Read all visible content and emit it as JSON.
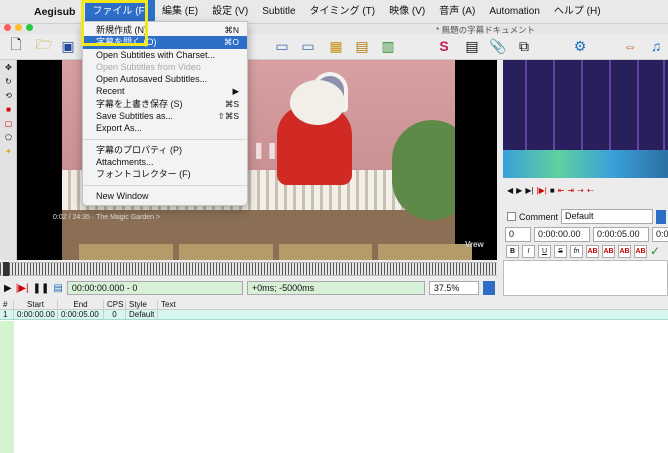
{
  "menubar": {
    "apple": "",
    "app_name": "Aegisub",
    "items": [
      {
        "label": "ファイル (F)",
        "active": true
      },
      {
        "label": "編集 (E)"
      },
      {
        "label": "設定 (V)"
      },
      {
        "label": "Subtitle"
      },
      {
        "label": "タイミング (T)"
      },
      {
        "label": "映像 (V)"
      },
      {
        "label": "音声 (A)"
      },
      {
        "label": "Automation"
      },
      {
        "label": "ヘルプ (H)"
      }
    ]
  },
  "window": {
    "title": "* 無題の字幕ドキュメント"
  },
  "file_menu": {
    "items": [
      {
        "label": "新規作成 (N)",
        "shortcut": "⌘N"
      },
      {
        "label": "字幕を開く (O)",
        "shortcut": "⌘O",
        "selected": true
      },
      {
        "label": "Open Subtitles with Charset..."
      },
      {
        "label": "Open Subtitles from Video",
        "disabled": true
      },
      {
        "label": "Open Autosaved Subtitles..."
      },
      {
        "label": "Recent",
        "shortcut": "▶"
      },
      {
        "label": "字幕を上書き保存 (S)",
        "shortcut": "⌘S"
      },
      {
        "label": "Save Subtitles as...",
        "shortcut": "⇧⌘S"
      },
      {
        "label": "Export As..."
      },
      {
        "separator": true
      },
      {
        "label": "字幕のプロパティ (P)"
      },
      {
        "label": "Attachments..."
      },
      {
        "label": "フォントコレクター (F)"
      },
      {
        "separator": true
      },
      {
        "label": "New Window"
      }
    ]
  },
  "video": {
    "caption": "0:02 / 24:35 · The Magic Garden >",
    "watermark": "Vrew"
  },
  "video_controls": {
    "time": "00:00:00.000 - 0",
    "offset": "+0ms; -5000ms",
    "zoom": "37.5%"
  },
  "edit_panel": {
    "comment_label": "Comment",
    "style": "Default",
    "layer": "0",
    "start": "0:00:00.00",
    "end": "0:00:05.00",
    "duration": "0:0",
    "format_buttons": [
      "B",
      "I",
      "U",
      "S",
      "fn",
      "AB",
      "AB",
      "AB",
      "AB"
    ]
  },
  "grid": {
    "columns": [
      "#",
      "Start",
      "End",
      "CPS",
      "Style",
      "Text"
    ],
    "rows": [
      {
        "num": "1",
        "start": "0:00:00.00",
        "end": "0:00:05.00",
        "cps": "0",
        "style": "Default",
        "text": ""
      }
    ]
  },
  "colors": {
    "accent": "#2d6ec9",
    "highlight": "#f0e81c",
    "grid_row": "#d8f6f1"
  }
}
